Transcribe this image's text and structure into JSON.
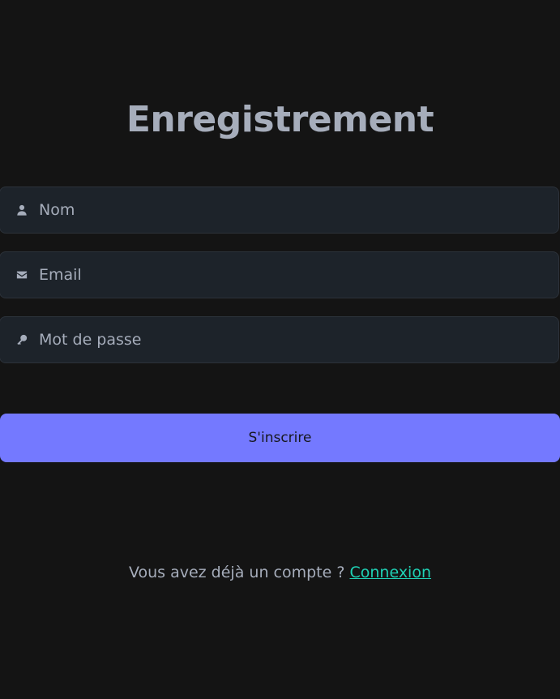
{
  "page": {
    "title": "Enregistrement"
  },
  "form": {
    "name_field": {
      "placeholder": "Nom",
      "value": "",
      "icon": "user-icon"
    },
    "email_field": {
      "placeholder": "Email",
      "value": "",
      "icon": "envelope-icon"
    },
    "password_field": {
      "placeholder": "Mot de passe",
      "value": "",
      "icon": "key-icon"
    },
    "submit_label": "S'inscrire"
  },
  "footer": {
    "prompt": "Vous avez déjà un compte ?",
    "login_link": "Connexion"
  },
  "colors": {
    "background": "#141414",
    "input_background": "#1d232a",
    "text": "#a6adbb",
    "primary": "#7479ff",
    "link": "#1fd1b5"
  }
}
